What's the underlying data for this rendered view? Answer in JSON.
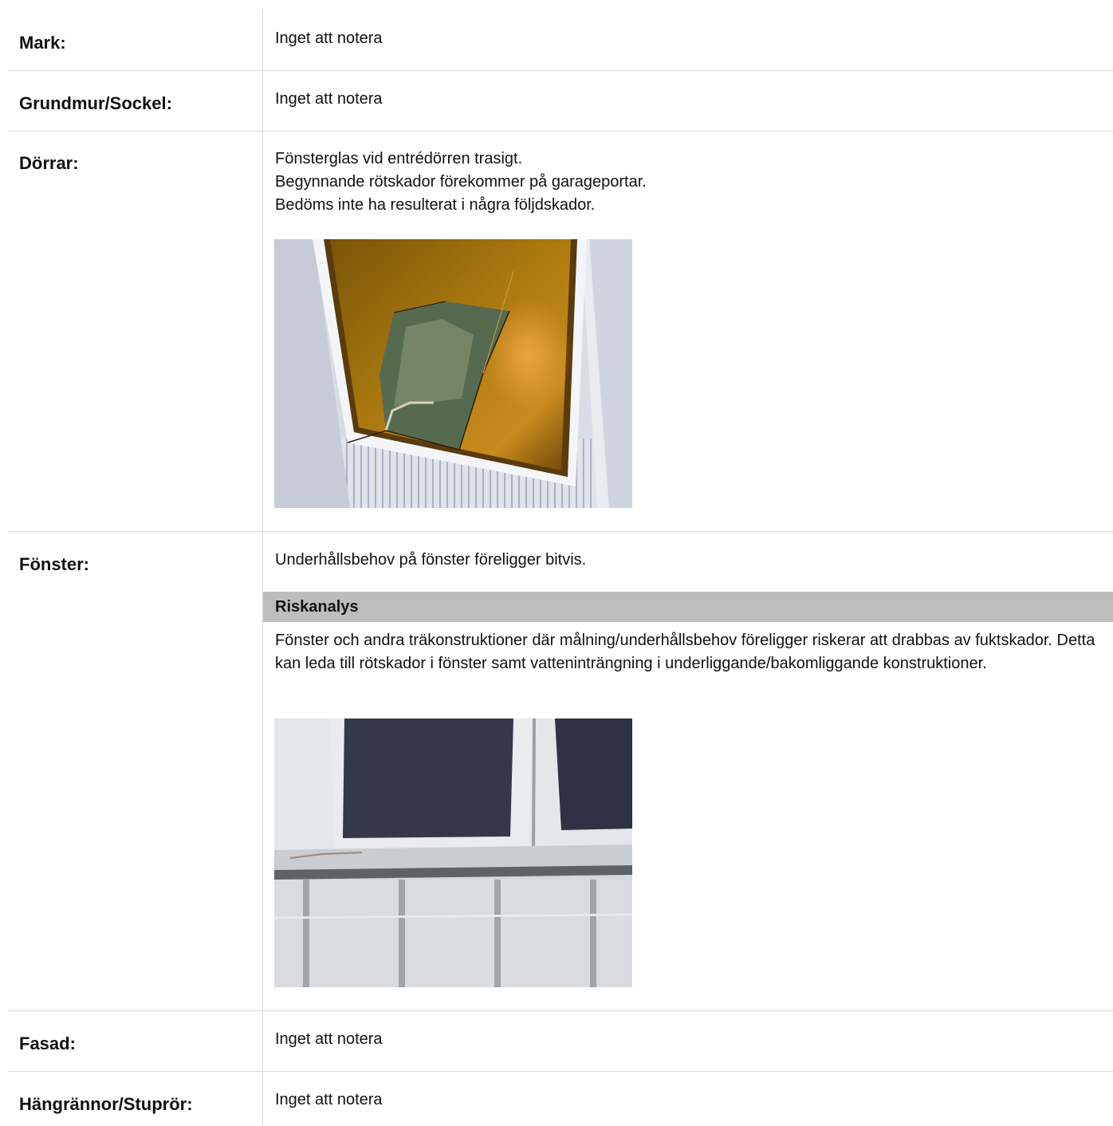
{
  "rows": [
    {
      "label": "Mark:",
      "text": "Inget att notera"
    },
    {
      "label": "Grundmur/Sockel:",
      "text": "Inget att notera"
    },
    {
      "label": "Dörrar:",
      "text": "Fönsterglas vid entrédörren trasigt.\nBegynnande rötskador förekommer på garageportar.\nBedöms inte ha resulterat i några följdskador."
    },
    {
      "label": "Fönster:",
      "text": "Underhållsbehov på fönster föreligger bitvis."
    },
    {
      "label": "Fasad:",
      "text": "Inget att notera"
    },
    {
      "label": "Hängrännor/Stuprör:",
      "text": "Inget att notera"
    }
  ],
  "risk": {
    "heading": "Riskanalys",
    "text": "Fönster och andra träkonstruktioner där målning/underhållsbehov föreligger riskerar att drabbas av fuktskador. Detta kan leda till rötskador i fönster samt vatteninträngning i underliggande/bakomliggande konstruktioner."
  }
}
